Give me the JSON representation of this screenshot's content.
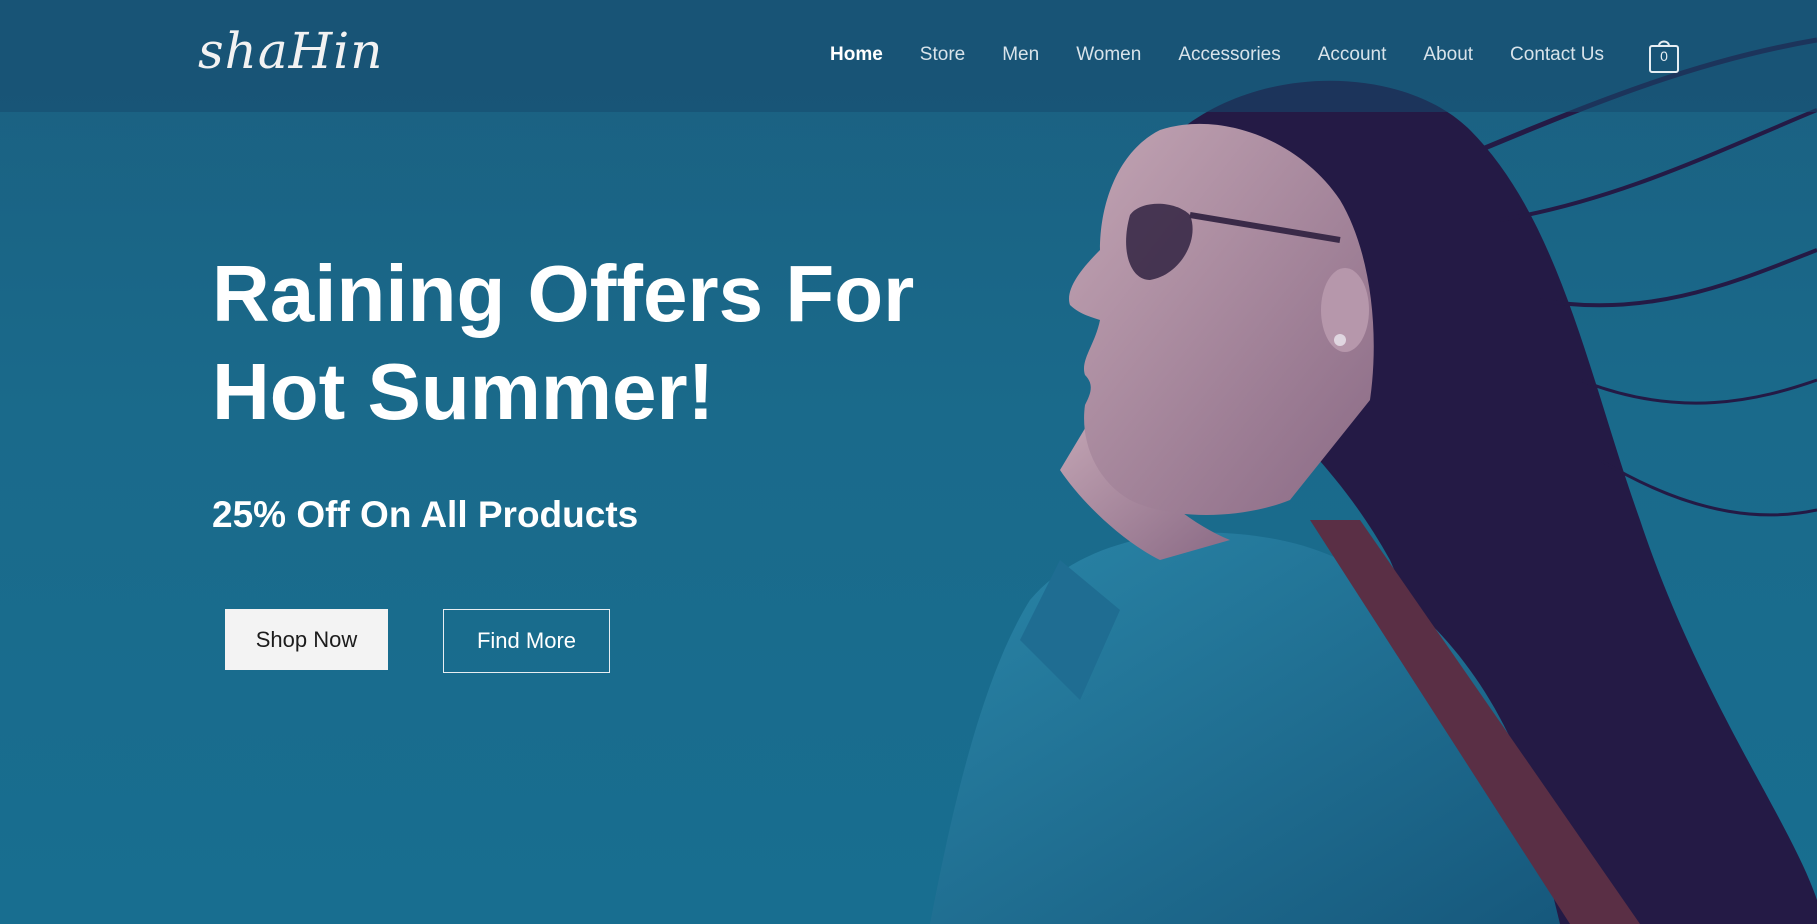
{
  "brand": {
    "logo_text": "shaHin"
  },
  "nav": {
    "items": [
      {
        "label": "Home",
        "active": true
      },
      {
        "label": "Store",
        "active": false
      },
      {
        "label": "Men",
        "active": false
      },
      {
        "label": "Women",
        "active": false
      },
      {
        "label": "Accessories",
        "active": false
      },
      {
        "label": "Account",
        "active": false
      },
      {
        "label": "About",
        "active": false
      },
      {
        "label": "Contact Us",
        "active": false
      }
    ]
  },
  "cart": {
    "count": "0",
    "icon": "shopping-bag-icon"
  },
  "hero": {
    "headline_line1": "Raining Offers For",
    "headline_line2": "Hot Summer!",
    "subheadline": "25% Off On All Products",
    "primary_button": "Shop Now",
    "secondary_button": "Find More"
  },
  "colors": {
    "background": "#1a6585",
    "header_overlay": "#164a6e",
    "text": "#ffffff",
    "button_light": "#f3f3f3"
  }
}
